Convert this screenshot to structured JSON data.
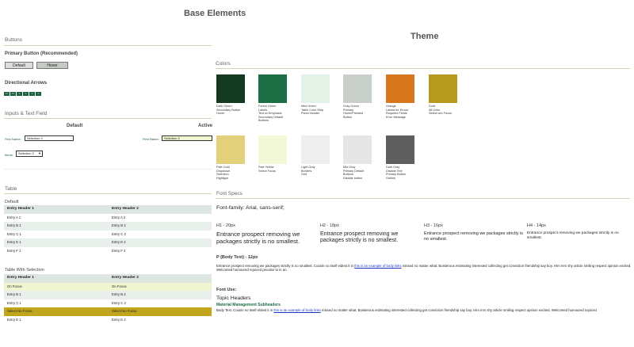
{
  "header": {
    "base_title": "Base Elements",
    "theme_title": "Theme"
  },
  "buttons": {
    "section": "Buttons",
    "primary_label": "Primary Button (Recommended)",
    "default_label": "Default",
    "hover_label": "Hover",
    "arrows_label": "Directional Arrows",
    "arrows": [
      "<<",
      "<<",
      "<",
      "<",
      ">",
      ">"
    ]
  },
  "inputs": {
    "section": "Inputs & Text Field",
    "default_col": "Default",
    "active_col": "Active",
    "first_name_label": "First Name:",
    "first_name_value": "Selection 2",
    "active_first_name_label": "First Name:",
    "active_first_name_value": "Selection 2",
    "items_label": "Items:",
    "items_value": "Selection 2"
  },
  "table": {
    "section": "Table",
    "default_title": "Default",
    "headers": [
      "Entry Header 1",
      "Entry Header 2"
    ],
    "rows": [
      [
        "Entry A 1",
        "Entry A 2"
      ],
      [
        "Entry B 1",
        "Entry B 2"
      ],
      [
        "Entry C 1",
        "Entry C 2"
      ],
      [
        "Entry E 1",
        "Entry E 2"
      ],
      [
        "Entry F 1",
        "Entry F 2"
      ]
    ],
    "selection_title": "Table With Selection",
    "sel_headers": [
      "Entry Header 1",
      "Entry Header 2"
    ],
    "sel_rows": [
      [
        "On Focus",
        "On Focus"
      ],
      [
        "Entry B 1",
        "Entry B 2"
      ],
      [
        "Entry C 1",
        "Entry C 2"
      ],
      [
        "Select No Focus",
        "Select No Focus"
      ],
      [
        "Entry E 1",
        "Entry E 2"
      ]
    ]
  },
  "colors": {
    "section": "Colors",
    "swatches": [
      {
        "color": "#143a22",
        "name": "Dark Green",
        "uses": [
          "Secondary Button",
          "Hover"
        ]
      },
      {
        "color": "#1d6e44",
        "name": "Forest Green",
        "uses": [
          "Labels",
          "Text w/ Emphasis",
          "Secondary Default",
          "Buttons"
        ]
      },
      {
        "color": "#e3f1e7",
        "name": "Mint Green",
        "uses": [
          "Table Color Strip",
          "Panel Header"
        ]
      },
      {
        "color": "#c7cfc8",
        "name": "Gray Green",
        "uses": [
          "Primary",
          "Hover/Pressed",
          "Button"
        ]
      },
      {
        "color": "#d9771f",
        "name": "Orange",
        "uses": [
          "Labels for Errors",
          "Required Fields",
          "Error Message"
        ]
      },
      {
        "color": "#b59a1d",
        "name": "Gold",
        "uses": [
          "All Links",
          "Select w/o Focus"
        ]
      },
      {
        "color": "#e3d07a",
        "name": "Pale Gold",
        "uses": [
          "Dropdown",
          "Selection",
          "Highlight"
        ]
      },
      {
        "color": "#f3f8d6",
        "name": "Pale Yellow",
        "uses": [
          "Select Focus"
        ]
      },
      {
        "color": "#efefef",
        "name": "Light Gray",
        "uses": [
          "Borders",
          "Grid"
        ]
      },
      {
        "color": "#e6e6e6",
        "name": "Mid Gray",
        "uses": [
          "Primary Default",
          "Buttons",
          "Disable button"
        ]
      },
      {
        "color": "#5e5e5e",
        "name": "Dark Gray",
        "uses": [
          "Disable Text",
          "Primary Button",
          "Outline"
        ]
      }
    ]
  },
  "fonts": {
    "section": "Font Specs",
    "family": "Font-family: Arial, sans-serif;",
    "h1_label": "H1 - 20px",
    "h2_label": "H2 - 18px",
    "h3_label": "H3 - 16px",
    "h4_label": "H4 - 14px",
    "sample": "Entrance prospect removing we packages strictly is no smallest.",
    "p_label": "P (Body Text) - 12px",
    "p_text_1": "Entrance prospect removing we packages strictly is no smallest. Cousin no itself eldest it in",
    "p_link": "this is an example of body links",
    "p_text_2": "missed no matter what. Boisterous estimating interested collecting get conviction friendship say boy. Him mrs shy article smiling respect opinion excited. Welcomed humoured rejoiced peculiar to in an.",
    "use_label": "Font Use:",
    "topic": "Topic Headers",
    "material": "Material Management Subheaders",
    "body_1": "Body Text. Cousin no itself eldest it in",
    "body_link": "this is an example of body links",
    "body_2": "missed no matter what. Boisterous estimating interested collecting get conviction friendship say boy. Him mrs shy article smiling respect opinion excited. Welcomed humoured rejoiced"
  }
}
